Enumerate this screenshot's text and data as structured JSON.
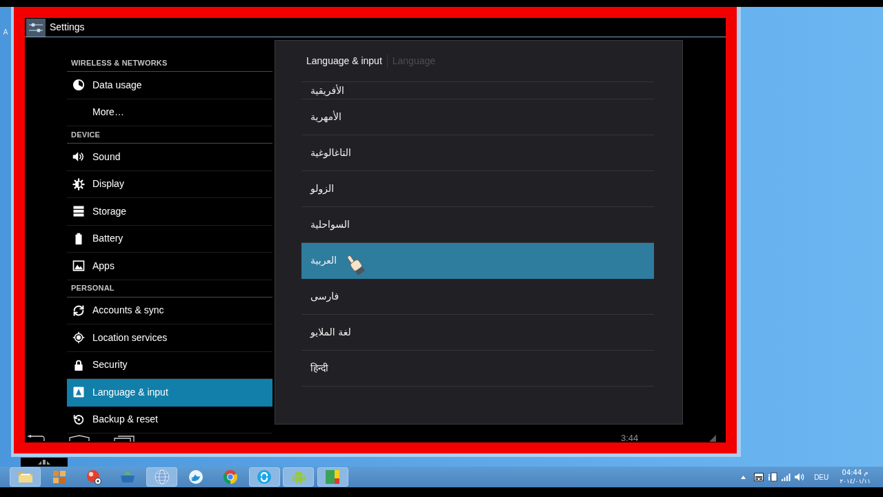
{
  "desktop": {
    "edge_label": "A"
  },
  "emulator": {
    "action_bar": {
      "title": "Settings"
    },
    "sidebar": {
      "sections": [
        {
          "header": "WIRELESS & NETWORKS",
          "items": [
            {
              "label": "Data usage",
              "selected": false
            },
            {
              "label": "More…",
              "selected": false
            }
          ]
        },
        {
          "header": "DEVICE",
          "items": [
            {
              "label": "Sound",
              "selected": false
            },
            {
              "label": "Display",
              "selected": false
            },
            {
              "label": "Storage",
              "selected": false
            },
            {
              "label": "Battery",
              "selected": false
            },
            {
              "label": "Apps",
              "selected": false
            }
          ]
        },
        {
          "header": "PERSONAL",
          "items": [
            {
              "label": "Accounts & sync",
              "selected": false
            },
            {
              "label": "Location services",
              "selected": false
            },
            {
              "label": "Security",
              "selected": false
            },
            {
              "label": "Language & input",
              "selected": true
            },
            {
              "label": "Backup & reset",
              "selected": false
            }
          ]
        }
      ]
    },
    "dialog": {
      "title": "Language & input",
      "subtitle": "Language",
      "languages": [
        {
          "label": "الأفريقية",
          "selected": false
        },
        {
          "label": "الأمهرية",
          "selected": false
        },
        {
          "label": "التاغالوغية",
          "selected": false
        },
        {
          "label": "الزولو",
          "selected": false
        },
        {
          "label": "السواحلية",
          "selected": false
        },
        {
          "label": "العربية",
          "selected": true
        },
        {
          "label": "فارسی",
          "selected": false
        },
        {
          "label": "لغة الملايو",
          "selected": false
        },
        {
          "label": "हिन्दी",
          "selected": false
        }
      ]
    },
    "nav_bar": {
      "clock": "3:44"
    }
  },
  "taskbar": {
    "apps": [
      {
        "running": true
      },
      {
        "running": false
      },
      {
        "running": false
      },
      {
        "running": false
      },
      {
        "running": true
      },
      {
        "running": false
      },
      {
        "running": false
      },
      {
        "running": true
      },
      {
        "running": true
      },
      {
        "running": true
      }
    ],
    "tray": {
      "language": "DEU",
      "time": "04:44 م",
      "date": "٢٠١٤/٠١/١١"
    }
  }
}
